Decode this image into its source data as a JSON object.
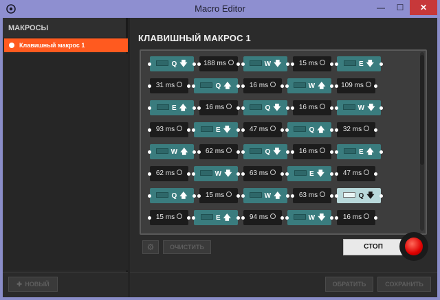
{
  "window": {
    "title": "Macro Editor",
    "minimize": "—",
    "maximize": "☐",
    "close": "✕"
  },
  "sidebar": {
    "header": "МАКРОСЫ",
    "macros": [
      {
        "label": "Клавишный макрос 1",
        "selected": true
      }
    ],
    "new_button": "НОВЫЙ",
    "new_plus": "✚"
  },
  "main": {
    "title": "КЛАВИШНЫЙ МАКРОС 1",
    "clear_button": "ОЧИСТИТЬ",
    "stop_button": "СТОП",
    "revert_button": "ОБРАТИТЬ",
    "save_button": "СОХРАНИТЬ"
  },
  "colors": {
    "accent": "#ff5a1f",
    "key_node": "#3a7c7e",
    "delay_node": "#1c1c1c",
    "record_led": "#dd1111"
  },
  "sequence": [
    [
      {
        "t": "key",
        "k": "Q",
        "d": "down"
      },
      {
        "t": "delay",
        "v": "188 ms"
      },
      {
        "t": "key",
        "k": "W",
        "d": "down"
      },
      {
        "t": "delay",
        "v": "15 ms"
      },
      {
        "t": "key",
        "k": "E",
        "d": "down"
      }
    ],
    [
      {
        "t": "delay",
        "v": "31 ms"
      },
      {
        "t": "key",
        "k": "Q",
        "d": "up"
      },
      {
        "t": "delay",
        "v": "16 ms"
      },
      {
        "t": "key",
        "k": "W",
        "d": "up"
      },
      {
        "t": "delay",
        "v": "109 ms"
      }
    ],
    [
      {
        "t": "key",
        "k": "E",
        "d": "up"
      },
      {
        "t": "delay",
        "v": "16 ms"
      },
      {
        "t": "key",
        "k": "Q",
        "d": "down"
      },
      {
        "t": "delay",
        "v": "16 ms"
      },
      {
        "t": "key",
        "k": "W",
        "d": "down"
      }
    ],
    [
      {
        "t": "delay",
        "v": "93 ms"
      },
      {
        "t": "key",
        "k": "E",
        "d": "down"
      },
      {
        "t": "delay",
        "v": "47 ms"
      },
      {
        "t": "key",
        "k": "Q",
        "d": "up"
      },
      {
        "t": "delay",
        "v": "32 ms"
      }
    ],
    [
      {
        "t": "key",
        "k": "W",
        "d": "up"
      },
      {
        "t": "delay",
        "v": "62 ms"
      },
      {
        "t": "key",
        "k": "Q",
        "d": "down"
      },
      {
        "t": "delay",
        "v": "16 ms"
      },
      {
        "t": "key",
        "k": "E",
        "d": "up"
      }
    ],
    [
      {
        "t": "delay",
        "v": "62 ms"
      },
      {
        "t": "key",
        "k": "W",
        "d": "down"
      },
      {
        "t": "delay",
        "v": "63 ms"
      },
      {
        "t": "key",
        "k": "E",
        "d": "down"
      },
      {
        "t": "delay",
        "v": "47 ms"
      }
    ],
    [
      {
        "t": "key",
        "k": "Q",
        "d": "up"
      },
      {
        "t": "delay",
        "v": "15 ms"
      },
      {
        "t": "key",
        "k": "W",
        "d": "up"
      },
      {
        "t": "delay",
        "v": "63 ms"
      },
      {
        "t": "key",
        "k": "Q",
        "d": "down",
        "light": true
      }
    ],
    [
      {
        "t": "delay",
        "v": "15 ms"
      },
      {
        "t": "key",
        "k": "E",
        "d": "up"
      },
      {
        "t": "delay",
        "v": "94 ms"
      },
      {
        "t": "key",
        "k": "W",
        "d": "down"
      },
      {
        "t": "delay",
        "v": "16 ms"
      }
    ]
  ]
}
